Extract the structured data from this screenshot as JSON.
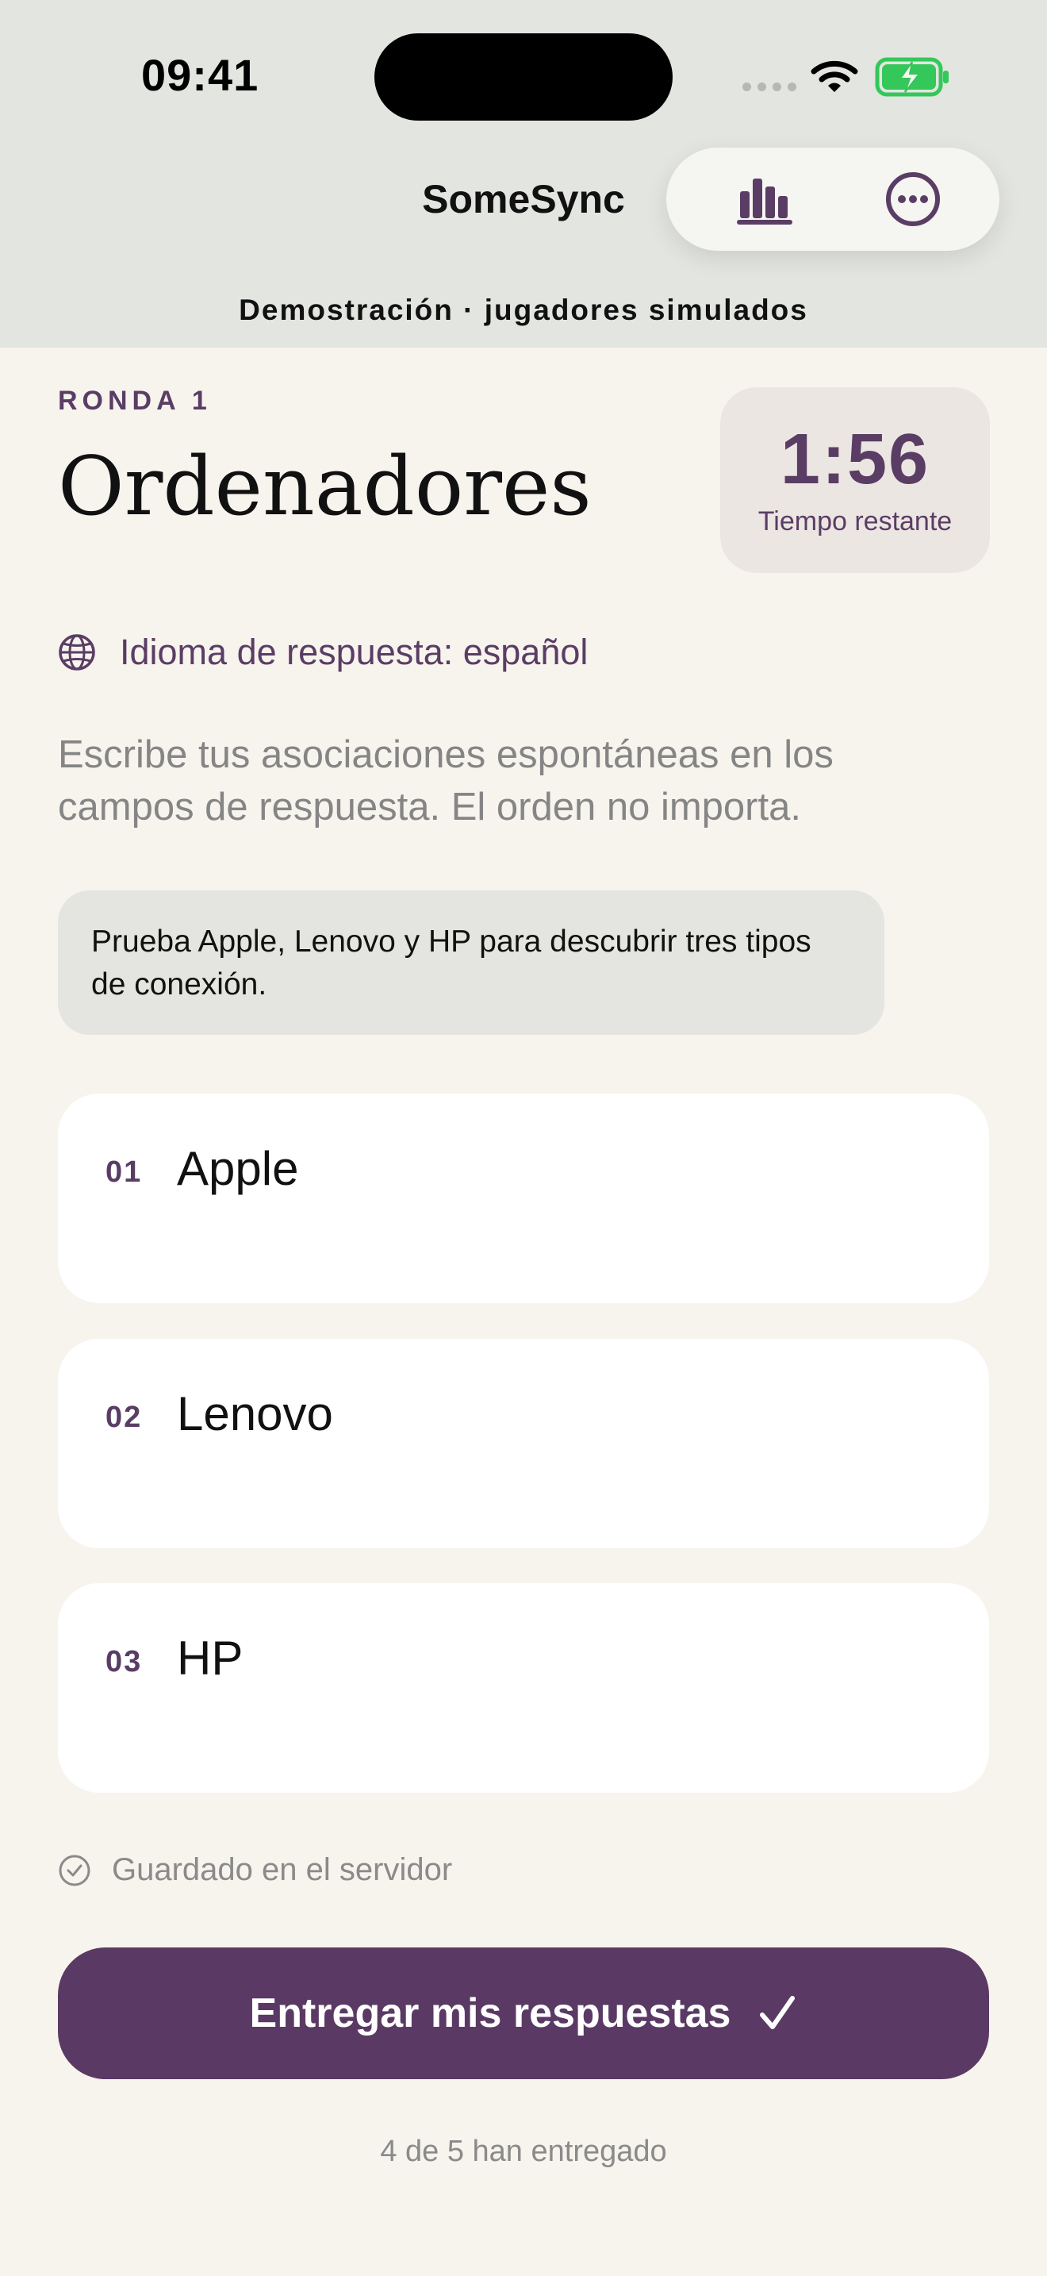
{
  "status_bar": {
    "time": "09:41",
    "icons": [
      "cellular-signal-icon",
      "wifi-icon",
      "battery-charging-icon"
    ]
  },
  "header": {
    "app_title": "SomeSync",
    "actions": [
      "bar-chart-icon",
      "more-options-icon"
    ],
    "demo_label": "Demostración · jugadores simulados"
  },
  "round": {
    "label": "RONDA 1",
    "category": "Ordenadores"
  },
  "timer": {
    "value": "1:56",
    "caption": "Tiempo restante"
  },
  "language": {
    "icon": "globe-icon",
    "text": "Idioma de respuesta: español"
  },
  "instructions": "Escribe tus asociaciones espontáneas en los campos de respuesta. El orden no importa.",
  "hint": "Prueba Apple, Lenovo y HP para descubrir tres tipos de conexión.",
  "answers": [
    {
      "number": "01",
      "value": "Apple"
    },
    {
      "number": "02",
      "value": "Lenovo"
    },
    {
      "number": "03",
      "value": "HP"
    }
  ],
  "save_status": {
    "icon": "check-circle-icon",
    "text": "Guardado en el servidor"
  },
  "submit": {
    "label": "Entregar mis respuestas",
    "icon": "checkmark-icon"
  },
  "submitted_count": "4 de 5 han entregado",
  "colors": {
    "accent": "#5a3d64",
    "header_bg": "#e3e5e0",
    "page_bg": "#f7f4ee",
    "card_bg": "#ffffff",
    "hint_bg": "#e4e5e0",
    "timer_bg": "#ece6e3"
  }
}
